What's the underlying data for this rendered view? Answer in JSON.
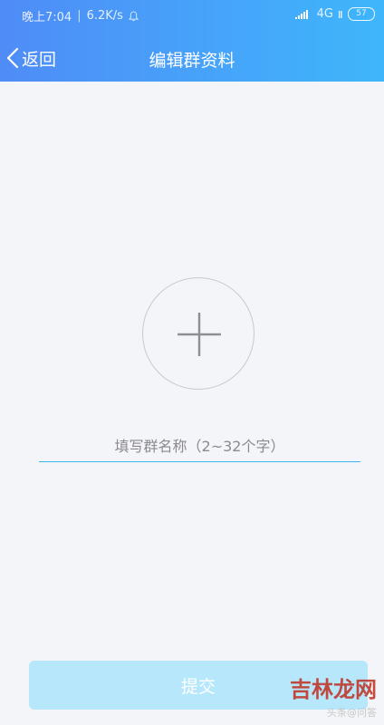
{
  "status_bar": {
    "time": "晚上7:04",
    "separator": "|",
    "speed": "6.2K/s",
    "network": "4G",
    "battery": "57"
  },
  "nav": {
    "back_label": "返回",
    "title": "编辑群资料"
  },
  "form": {
    "name_placeholder": "填写群名称（2~32个字）",
    "name_value": "",
    "submit_label": "提交"
  },
  "watermark": {
    "main": "吉林龙网",
    "sub": "头条@问答"
  },
  "colors": {
    "header_start": "#4f8cf7",
    "header_end": "#3fb6fb",
    "field_underline": "#3db5f3",
    "submit_bg": "#b6e7fb"
  }
}
